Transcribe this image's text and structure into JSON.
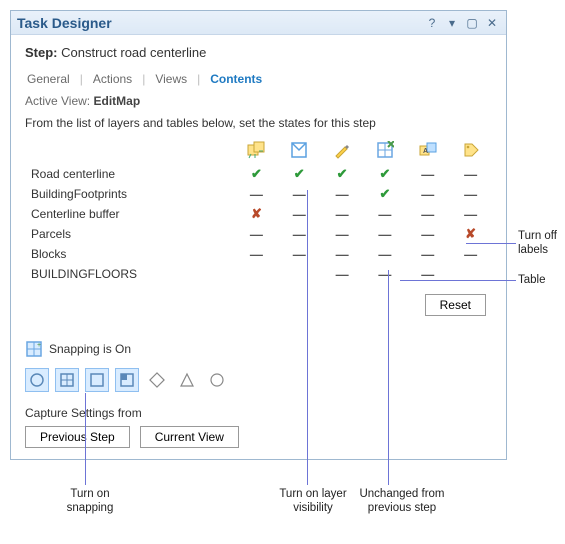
{
  "window": {
    "title": "Task Designer"
  },
  "step": {
    "label": "Step:",
    "name": "Construct road centerline"
  },
  "tabs": {
    "items": [
      "General",
      "Actions",
      "Views",
      "Contents"
    ],
    "active_index": 3
  },
  "active_view": {
    "label": "Active View:",
    "value": "EditMap"
  },
  "instruction": "From the list of layers and tables below, set the states for this step",
  "columns": [
    "selectable",
    "visible",
    "editable",
    "snappable",
    "labels",
    "tag"
  ],
  "layers": [
    {
      "name": "Road centerline",
      "states": [
        "check",
        "check",
        "check",
        "check",
        "none",
        "none"
      ]
    },
    {
      "name": "BuildingFootprints",
      "states": [
        "none",
        "none",
        "none",
        "check",
        "none",
        "none"
      ]
    },
    {
      "name": "Centerline buffer",
      "states": [
        "xmark",
        "none",
        "none",
        "none",
        "none",
        "none"
      ]
    },
    {
      "name": "Parcels",
      "states": [
        "none",
        "none",
        "none",
        "none",
        "none",
        "xmark"
      ]
    },
    {
      "name": "Blocks",
      "states": [
        "none",
        "none",
        "none",
        "none",
        "none",
        "none"
      ]
    },
    {
      "name": "BUILDINGFLOORS",
      "states": [
        "",
        "",
        "none",
        "none",
        "none",
        ""
      ]
    }
  ],
  "reset_label": "Reset",
  "snapping": {
    "title": "Snapping is On",
    "tools": [
      {
        "name": "point-snap",
        "active": true
      },
      {
        "name": "intersection-snap",
        "active": true
      },
      {
        "name": "edge-snap",
        "active": true
      },
      {
        "name": "end-snap",
        "active": true
      },
      {
        "name": "midpoint-snap",
        "active": false
      },
      {
        "name": "vertex-snap",
        "active": false
      },
      {
        "name": "tangent-snap",
        "active": false
      }
    ]
  },
  "capture": {
    "label": "Capture Settings from",
    "previous": "Previous Step",
    "current": "Current View"
  },
  "annotations": {
    "turn_off_labels": "Turn off\nlabels",
    "table_note": "Table",
    "turn_on_snapping": "Turn on\nsnapping",
    "turn_on_visibility": "Turn on layer\nvisibility",
    "unchanged": "Unchanged from\nprevious step"
  }
}
